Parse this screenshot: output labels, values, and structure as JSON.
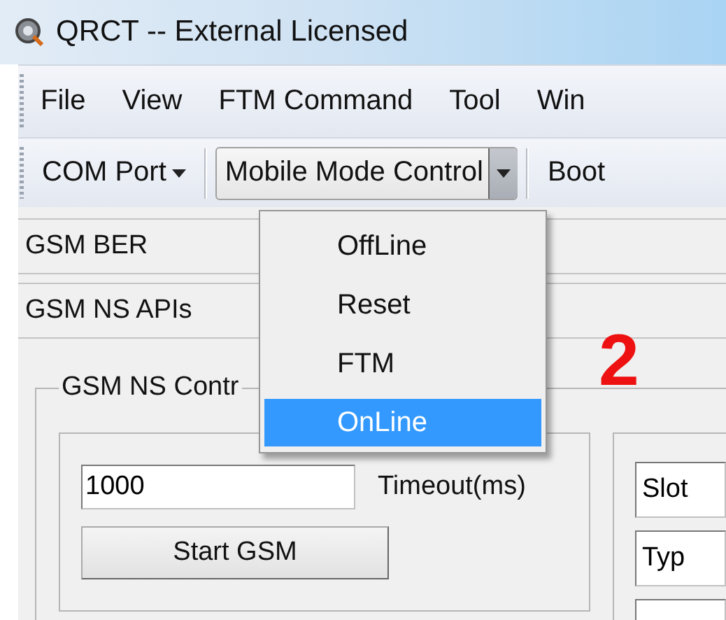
{
  "window": {
    "title": "QRCT -- External Licensed"
  },
  "menu_bar": [
    {
      "label": "File"
    },
    {
      "label": "View"
    },
    {
      "label": "FTM Command"
    },
    {
      "label": "Tool"
    },
    {
      "label": "Win"
    }
  ],
  "toolbar": [
    {
      "kind": "dropdown",
      "label": "COM Port",
      "pressed": false
    },
    {
      "kind": "split",
      "label": "Mobile Mode Control",
      "pressed": true
    },
    {
      "kind": "button",
      "label": "Boot",
      "pressed": false
    }
  ],
  "panels": [
    {
      "label": "GSM BER"
    },
    {
      "label": "GSM NS APIs"
    }
  ],
  "control_group": {
    "title": "GSM NS Contr",
    "timeout_field": {
      "value": "1000"
    },
    "timeout_label": "Timeout(ms)",
    "start_button": "Start GSM",
    "side_fields": [
      {
        "kind": "text",
        "value": "Slot"
      },
      {
        "kind": "text",
        "value": "Typ"
      },
      {
        "kind": "cut"
      }
    ]
  },
  "mode_menu": {
    "items": [
      {
        "label": "OffLine",
        "selected": false
      },
      {
        "label": "Reset",
        "selected": false
      },
      {
        "label": "FTM",
        "selected": false
      },
      {
        "label": "OnLine",
        "selected": true
      }
    ]
  },
  "annotation": "2"
}
